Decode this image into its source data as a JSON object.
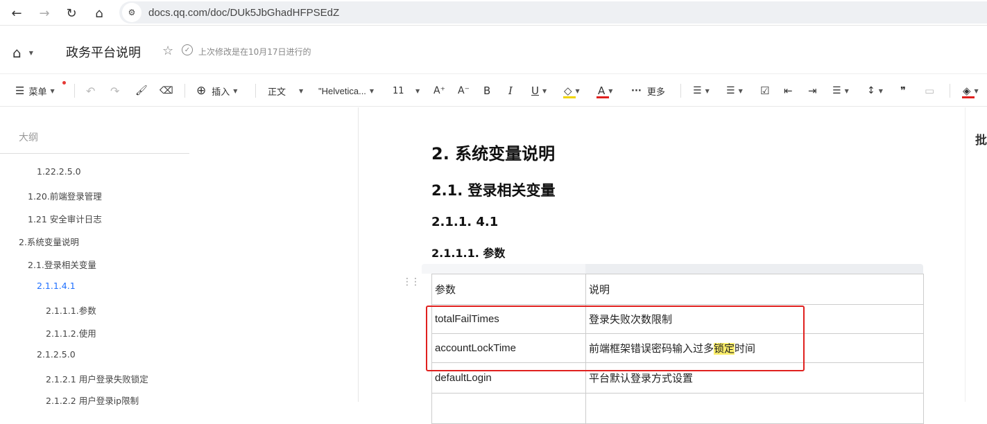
{
  "browser": {
    "url": "docs.qq.com/doc/DUk5JbGhadHFPSEdZ",
    "back_icon": "←",
    "forward_icon": "→",
    "reload_icon": "↻",
    "home_icon": "⌂",
    "site_icon": "⚙"
  },
  "header": {
    "title": "政务平台说明",
    "last_modified": "上次修改是在10月17日进行的",
    "star_icon": "☆",
    "check_icon": "✓",
    "home_icon": "⌂"
  },
  "toolbar": {
    "menu_label": "菜单",
    "insert_label": "插入",
    "paragraph_style": "正文",
    "font_family": "\"Helvetica...",
    "font_size": "11",
    "more_label": "更多",
    "icons": {
      "menu": "☰",
      "undo": "↶",
      "redo": "↷",
      "format_painter": "🖌",
      "clear_format": "⌫",
      "insert": "⊕",
      "increase_font": "A⁺",
      "decrease_font": "A⁻",
      "bold": "B",
      "italic": "I",
      "underline": "U",
      "highlight": "◇",
      "font_color": "A",
      "more": "···",
      "bullet_list": "☰",
      "numbered_list": "☰",
      "checklist": "☑",
      "outdent": "⇤",
      "indent": "⇥",
      "align": "☰",
      "line_spacing": "↕",
      "quote": "❞",
      "divider": "▭",
      "fill": "◈"
    }
  },
  "outline": {
    "title": "大纲",
    "items": [
      {
        "label": "1.22.2.5.0",
        "active": false
      },
      {
        "label": "1.20.前端登录管理",
        "active": false
      },
      {
        "label": "1.21  安全审计日志",
        "active": false
      },
      {
        "label": "2.系统变量说明",
        "active": false
      },
      {
        "label": "2.1.登录相关变量",
        "active": false
      },
      {
        "label": "2.1.1.4.1",
        "active": true
      },
      {
        "label": "2.1.1.1.参数",
        "active": false
      },
      {
        "label": "2.1.1.2.使用",
        "active": false
      },
      {
        "label": "2.1.2.5.0",
        "active": false
      },
      {
        "label": "2.1.2.1  用户登录失败锁定",
        "active": false
      },
      {
        "label": "2.1.2.2  用户登录ip限制",
        "active": false
      }
    ]
  },
  "document": {
    "h1": "2.   系统变量说明",
    "h2": "2.1.   登录相关变量",
    "h3": "2.1.1.   4.1",
    "h4": "2.1.1.1.   参数",
    "drag_icon": "⋮⋮",
    "table": {
      "headers": [
        "参数",
        "说明"
      ],
      "rows": [
        [
          "totalFailTimes",
          "登录失败次数限制"
        ],
        [
          "accountLockTime",
          "前端框架错误密码输入过多",
          "锁定",
          "时间"
        ],
        [
          "defaultLogin",
          "平台默认登录方式设置"
        ]
      ]
    }
  },
  "right_panel": {
    "label": "批注"
  }
}
